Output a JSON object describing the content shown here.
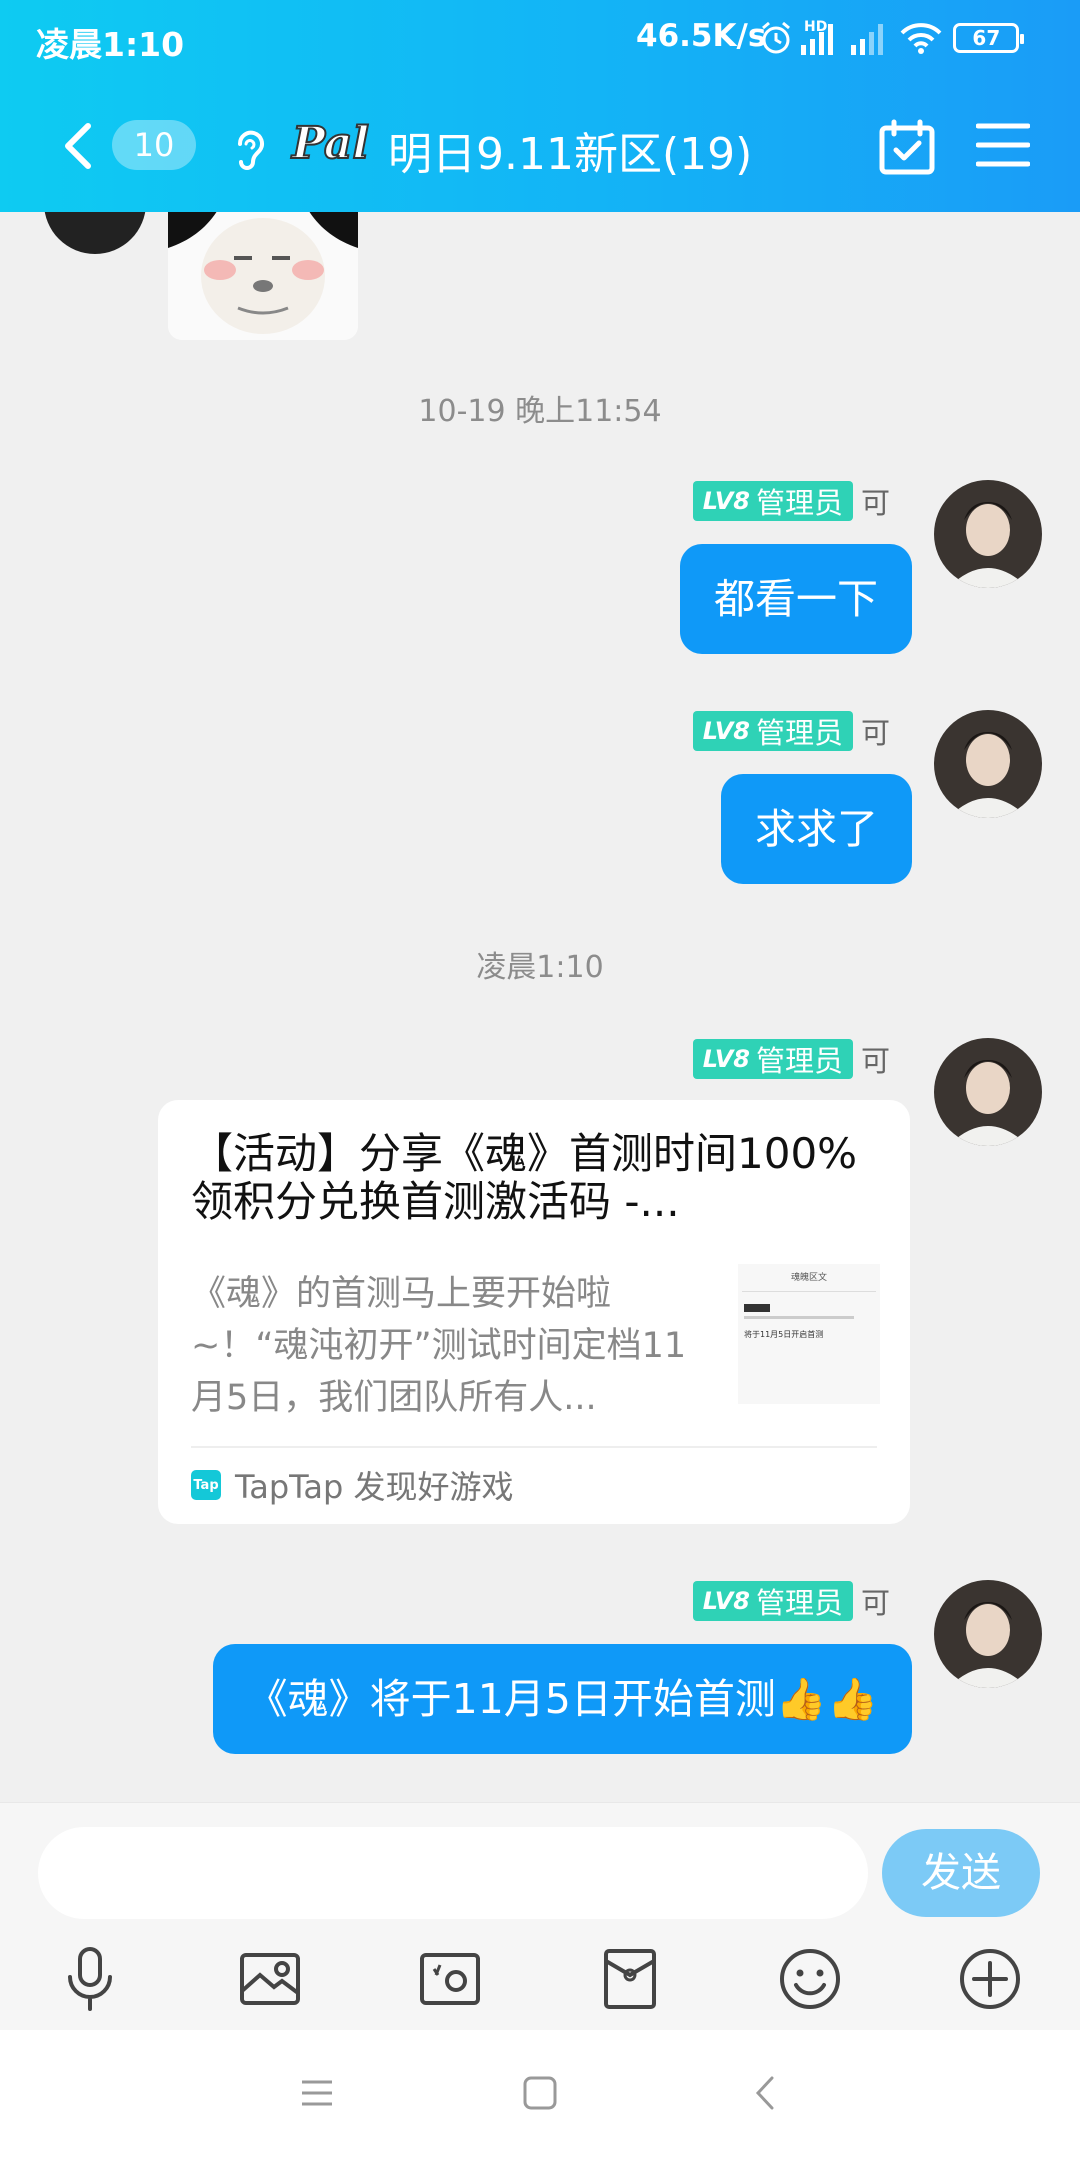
{
  "status_bar": {
    "time": "凌晨1:10",
    "speed": "46.5K/s",
    "hd": "HD",
    "battery": "67"
  },
  "header": {
    "unread_count": "10",
    "title": "明日9.11新区(19)",
    "logo_text": "Pal"
  },
  "timestamps": {
    "first": "10-19 晚上11:54",
    "second": "凌晨1:10"
  },
  "sender": {
    "level": "LV8",
    "role": "管理员",
    "nick": "可"
  },
  "messages": [
    {
      "text": "都看一下"
    },
    {
      "text": "求求了"
    },
    {
      "text": "《魂》将于11月5日开始首测👍👍"
    }
  ],
  "share_card": {
    "title": "【活动】分享《魂》首测时间100%领积分兑换首测激活码 -...",
    "desc": "《魂》的首测马上要开始啦~！“魂沌初开”测试时间定档11月5日，我们团队所有人...",
    "thumb_heading": "魂魄区文",
    "thumb_line": "将于11月5日开启首测",
    "source_icon": "Tap",
    "source": "TapTap 发现好游戏"
  },
  "input": {
    "placeholder": "",
    "send_label": "发送"
  },
  "colors": {
    "header_start": "#0ecbf2",
    "header_end": "#1a9cf7",
    "bubble": "#0f99f8",
    "level_tag": "#2fd2b6",
    "send_disabled": "#7ccaf6"
  }
}
